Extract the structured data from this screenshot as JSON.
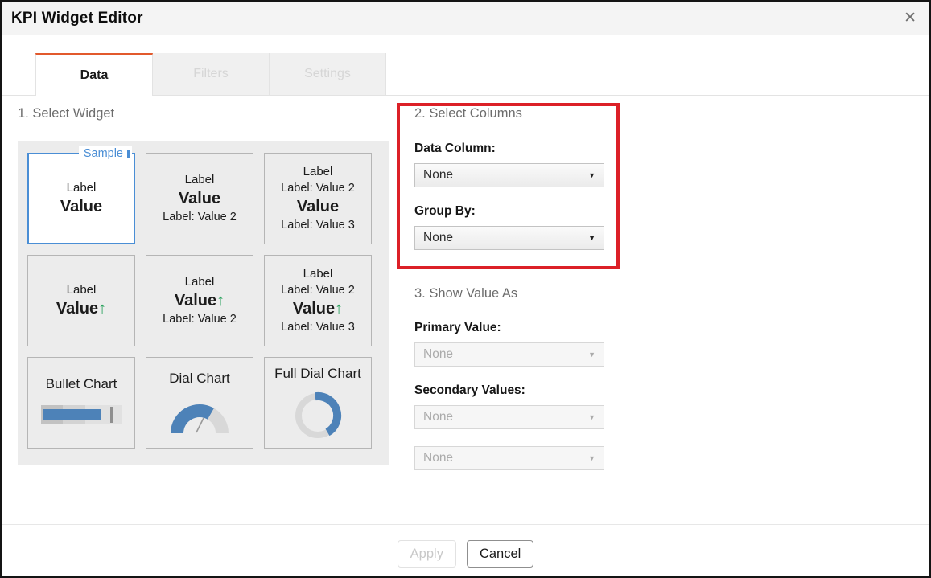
{
  "window": {
    "title": "KPI Widget Editor"
  },
  "icons": {
    "close": "✕",
    "dropdown_caret": "▼",
    "trend_up_arrow": "↑"
  },
  "colors": {
    "accent_orange": "#e2592c",
    "highlight_red": "#dc2027",
    "selection_blue": "#4a8ed5",
    "chart_blue": "#4d82b8",
    "trend_green": "#29a25d"
  },
  "tabs": {
    "data": "Data",
    "filters": "Filters",
    "settings": "Settings"
  },
  "select_widget": {
    "heading": "1. Select Widget",
    "sample_badge": "Sample",
    "cards": [
      {
        "label": "Label",
        "value": "Value"
      },
      {
        "label": "Label",
        "value": "Value",
        "sub_bottom": "Label: Value 2"
      },
      {
        "label": "Label",
        "sub_top": "Label: Value 2",
        "value": "Value",
        "sub_bottom": "Label: Value 3"
      },
      {
        "label": "Label",
        "value": "Value",
        "trend": "up"
      },
      {
        "label": "Label",
        "value": "Value",
        "trend": "up",
        "sub_bottom": "Label: Value 2"
      },
      {
        "label": "Label",
        "sub_top": "Label: Value 2",
        "value": "Value",
        "trend": "up",
        "sub_bottom": "Label: Value 3"
      },
      {
        "title": "Bullet Chart"
      },
      {
        "title": "Dial Chart"
      },
      {
        "title": "Full Dial Chart"
      }
    ]
  },
  "select_columns": {
    "heading": "2. Select Columns",
    "data_column": {
      "label": "Data Column:",
      "value": "None"
    },
    "group_by": {
      "label": "Group By:",
      "value": "None"
    }
  },
  "show_value_as": {
    "heading": "3. Show Value As",
    "primary": {
      "label": "Primary Value:",
      "value": "None"
    },
    "secondary": {
      "label": "Secondary Values:",
      "value_1": "None",
      "value_2": "None"
    }
  },
  "footer": {
    "apply": "Apply",
    "cancel": "Cancel"
  }
}
